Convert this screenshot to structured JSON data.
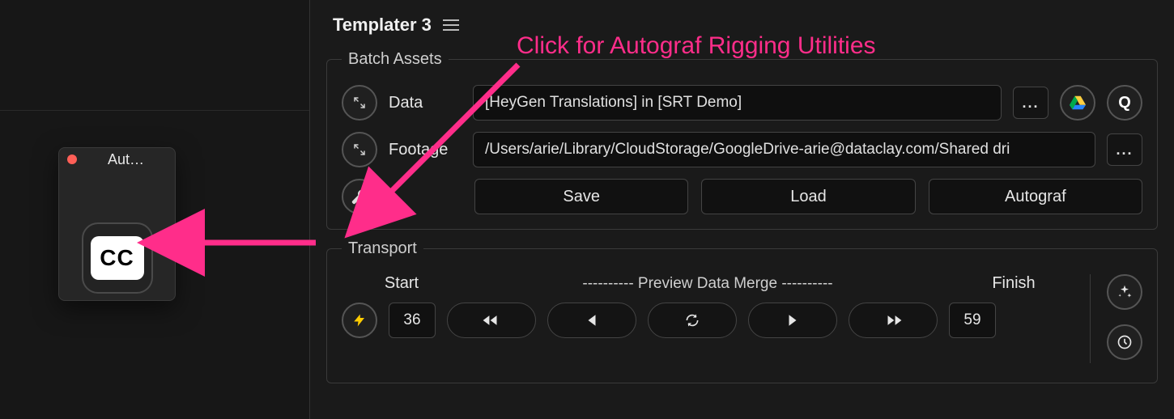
{
  "leftPanel": {
    "title": "Aut…",
    "ccLabel": "CC"
  },
  "panel": {
    "title": "Templater 3"
  },
  "batchAssets": {
    "legend": "Batch Assets",
    "dataLabel": "Data",
    "dataValue": "[HeyGen Translations] in [SRT Demo]",
    "footageLabel": "Footage",
    "footageValue": "/Users/arie/Library/CloudStorage/GoogleDrive-arie@dataclay.com/Shared dri",
    "ellipsis": "...",
    "qLabel": "Q",
    "save": "Save",
    "load": "Load",
    "autograf": "Autograf"
  },
  "transport": {
    "legend": "Transport",
    "startLabel": "Start",
    "finishLabel": "Finish",
    "previewLabel": "----------   Preview Data Merge   ----------",
    "startValue": "36",
    "finishValue": "59"
  },
  "annotation": {
    "text": "Click for Autograf Rigging Utilities"
  }
}
